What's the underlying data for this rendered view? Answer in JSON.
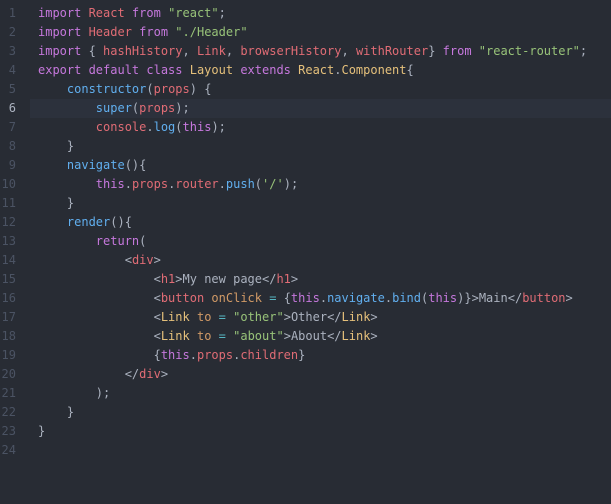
{
  "editor": {
    "activeLine": 6,
    "lines": [
      {
        "n": 1,
        "tokens": [
          {
            "t": "import ",
            "c": "k"
          },
          {
            "t": "React",
            "c": "var"
          },
          {
            "t": " from ",
            "c": "k"
          },
          {
            "t": "\"react\"",
            "c": "s"
          },
          {
            "t": ";",
            "c": "p"
          }
        ]
      },
      {
        "n": 2,
        "tokens": [
          {
            "t": "import ",
            "c": "k"
          },
          {
            "t": "Header",
            "c": "var"
          },
          {
            "t": " from ",
            "c": "k"
          },
          {
            "t": "\"./Header\"",
            "c": "s"
          }
        ]
      },
      {
        "n": 3,
        "tokens": [
          {
            "t": "import ",
            "c": "k"
          },
          {
            "t": "{ ",
            "c": "p"
          },
          {
            "t": "hashHistory",
            "c": "var"
          },
          {
            "t": ", ",
            "c": "p"
          },
          {
            "t": "Link",
            "c": "var"
          },
          {
            "t": ", ",
            "c": "p"
          },
          {
            "t": "browserHistory",
            "c": "var"
          },
          {
            "t": ", ",
            "c": "p"
          },
          {
            "t": "withRouter",
            "c": "var"
          },
          {
            "t": "} ",
            "c": "p"
          },
          {
            "t": "from ",
            "c": "k"
          },
          {
            "t": "\"react-router\"",
            "c": "s"
          },
          {
            "t": ";",
            "c": "p"
          }
        ]
      },
      {
        "n": 4,
        "tokens": [
          {
            "t": "export ",
            "c": "k"
          },
          {
            "t": "default ",
            "c": "k"
          },
          {
            "t": "class ",
            "c": "k"
          },
          {
            "t": "Layout",
            "c": "cls"
          },
          {
            "t": " extends ",
            "c": "k"
          },
          {
            "t": "React",
            "c": "cls"
          },
          {
            "t": ".",
            "c": "p"
          },
          {
            "t": "Component",
            "c": "cls"
          },
          {
            "t": "{",
            "c": "p"
          }
        ]
      },
      {
        "n": 5,
        "indent": 1,
        "tokens": [
          {
            "t": "constructor",
            "c": "fn"
          },
          {
            "t": "(",
            "c": "p"
          },
          {
            "t": "props",
            "c": "var"
          },
          {
            "t": ") {",
            "c": "p"
          }
        ]
      },
      {
        "n": 6,
        "indent": 2,
        "tokens": [
          {
            "t": "super",
            "c": "fn"
          },
          {
            "t": "(",
            "c": "p"
          },
          {
            "t": "props",
            "c": "var"
          },
          {
            "t": ");",
            "c": "p"
          }
        ]
      },
      {
        "n": 7,
        "indent": 2,
        "tokens": [
          {
            "t": "console",
            "c": "var"
          },
          {
            "t": ".",
            "c": "p"
          },
          {
            "t": "log",
            "c": "fn"
          },
          {
            "t": "(",
            "c": "p"
          },
          {
            "t": "this",
            "c": "k"
          },
          {
            "t": ");",
            "c": "p"
          }
        ]
      },
      {
        "n": 8,
        "indent": 1,
        "tokens": [
          {
            "t": "}",
            "c": "p"
          }
        ]
      },
      {
        "n": 9,
        "indent": 1,
        "tokens": [
          {
            "t": "navigate",
            "c": "fn"
          },
          {
            "t": "(){",
            "c": "p"
          }
        ]
      },
      {
        "n": 10,
        "indent": 2,
        "tokens": [
          {
            "t": "this",
            "c": "k"
          },
          {
            "t": ".",
            "c": "p"
          },
          {
            "t": "props",
            "c": "prop"
          },
          {
            "t": ".",
            "c": "p"
          },
          {
            "t": "router",
            "c": "prop"
          },
          {
            "t": ".",
            "c": "p"
          },
          {
            "t": "push",
            "c": "fn"
          },
          {
            "t": "(",
            "c": "p"
          },
          {
            "t": "'/'",
            "c": "s"
          },
          {
            "t": ");",
            "c": "p"
          }
        ]
      },
      {
        "n": 11,
        "indent": 1,
        "tokens": [
          {
            "t": "}",
            "c": "p"
          }
        ]
      },
      {
        "n": 12,
        "indent": 1,
        "tokens": [
          {
            "t": "render",
            "c": "fn"
          },
          {
            "t": "(){",
            "c": "p"
          }
        ]
      },
      {
        "n": 13,
        "indent": 2,
        "tokens": [
          {
            "t": "return",
            "c": "k"
          },
          {
            "t": "(",
            "c": "p"
          }
        ]
      },
      {
        "n": 14,
        "indent": 3,
        "tokens": [
          {
            "t": "<",
            "c": "p"
          },
          {
            "t": "div",
            "c": "tag"
          },
          {
            "t": ">",
            "c": "p"
          }
        ]
      },
      {
        "n": 15,
        "indent": 4,
        "tokens": [
          {
            "t": "<",
            "c": "p"
          },
          {
            "t": "h1",
            "c": "tag"
          },
          {
            "t": ">",
            "c": "p"
          },
          {
            "t": "My new page",
            "c": "txt"
          },
          {
            "t": "</",
            "c": "p"
          },
          {
            "t": "h1",
            "c": "tag"
          },
          {
            "t": ">",
            "c": "p"
          }
        ]
      },
      {
        "n": 16,
        "indent": 4,
        "tokens": [
          {
            "t": "<",
            "c": "p"
          },
          {
            "t": "button",
            "c": "tag"
          },
          {
            "t": " ",
            "c": "p"
          },
          {
            "t": "onClick",
            "c": "attr"
          },
          {
            "t": " ",
            "c": "p"
          },
          {
            "t": "=",
            "c": "op"
          },
          {
            "t": " {",
            "c": "p"
          },
          {
            "t": "this",
            "c": "k"
          },
          {
            "t": ".",
            "c": "p"
          },
          {
            "t": "navigate",
            "c": "fn"
          },
          {
            "t": ".",
            "c": "p"
          },
          {
            "t": "bind",
            "c": "fn"
          },
          {
            "t": "(",
            "c": "p"
          },
          {
            "t": "this",
            "c": "k"
          },
          {
            "t": ")}>",
            "c": "p"
          },
          {
            "t": "Main",
            "c": "txt"
          },
          {
            "t": "</",
            "c": "p"
          },
          {
            "t": "button",
            "c": "tag"
          },
          {
            "t": ">",
            "c": "p"
          }
        ]
      },
      {
        "n": 17,
        "indent": 4,
        "tokens": [
          {
            "t": "<",
            "c": "p"
          },
          {
            "t": "Link",
            "c": "cls"
          },
          {
            "t": " ",
            "c": "p"
          },
          {
            "t": "to",
            "c": "attr"
          },
          {
            "t": " ",
            "c": "p"
          },
          {
            "t": "=",
            "c": "op"
          },
          {
            "t": " ",
            "c": "p"
          },
          {
            "t": "\"other\"",
            "c": "s"
          },
          {
            "t": ">",
            "c": "p"
          },
          {
            "t": "Other",
            "c": "txt"
          },
          {
            "t": "</",
            "c": "p"
          },
          {
            "t": "Link",
            "c": "cls"
          },
          {
            "t": ">",
            "c": "p"
          }
        ]
      },
      {
        "n": 18,
        "indent": 4,
        "tokens": [
          {
            "t": "<",
            "c": "p"
          },
          {
            "t": "Link",
            "c": "cls"
          },
          {
            "t": " ",
            "c": "p"
          },
          {
            "t": "to",
            "c": "attr"
          },
          {
            "t": " ",
            "c": "p"
          },
          {
            "t": "=",
            "c": "op"
          },
          {
            "t": " ",
            "c": "p"
          },
          {
            "t": "\"about\"",
            "c": "s"
          },
          {
            "t": ">",
            "c": "p"
          },
          {
            "t": "About",
            "c": "txt"
          },
          {
            "t": "</",
            "c": "p"
          },
          {
            "t": "Link",
            "c": "cls"
          },
          {
            "t": ">",
            "c": "p"
          }
        ]
      },
      {
        "n": 19,
        "indent": 4,
        "tokens": [
          {
            "t": "{",
            "c": "p"
          },
          {
            "t": "this",
            "c": "k"
          },
          {
            "t": ".",
            "c": "p"
          },
          {
            "t": "props",
            "c": "prop"
          },
          {
            "t": ".",
            "c": "p"
          },
          {
            "t": "children",
            "c": "prop"
          },
          {
            "t": "}",
            "c": "p"
          }
        ]
      },
      {
        "n": 20,
        "indent": 3,
        "tokens": [
          {
            "t": "</",
            "c": "p"
          },
          {
            "t": "div",
            "c": "tag"
          },
          {
            "t": ">",
            "c": "p"
          }
        ]
      },
      {
        "n": 21,
        "indent": 2,
        "tokens": [
          {
            "t": ");",
            "c": "p"
          }
        ]
      },
      {
        "n": 22,
        "indent": 1,
        "tokens": [
          {
            "t": "}",
            "c": "p"
          }
        ]
      },
      {
        "n": 23,
        "tokens": [
          {
            "t": "}",
            "c": "p"
          }
        ]
      },
      {
        "n": 24,
        "tokens": []
      }
    ]
  }
}
